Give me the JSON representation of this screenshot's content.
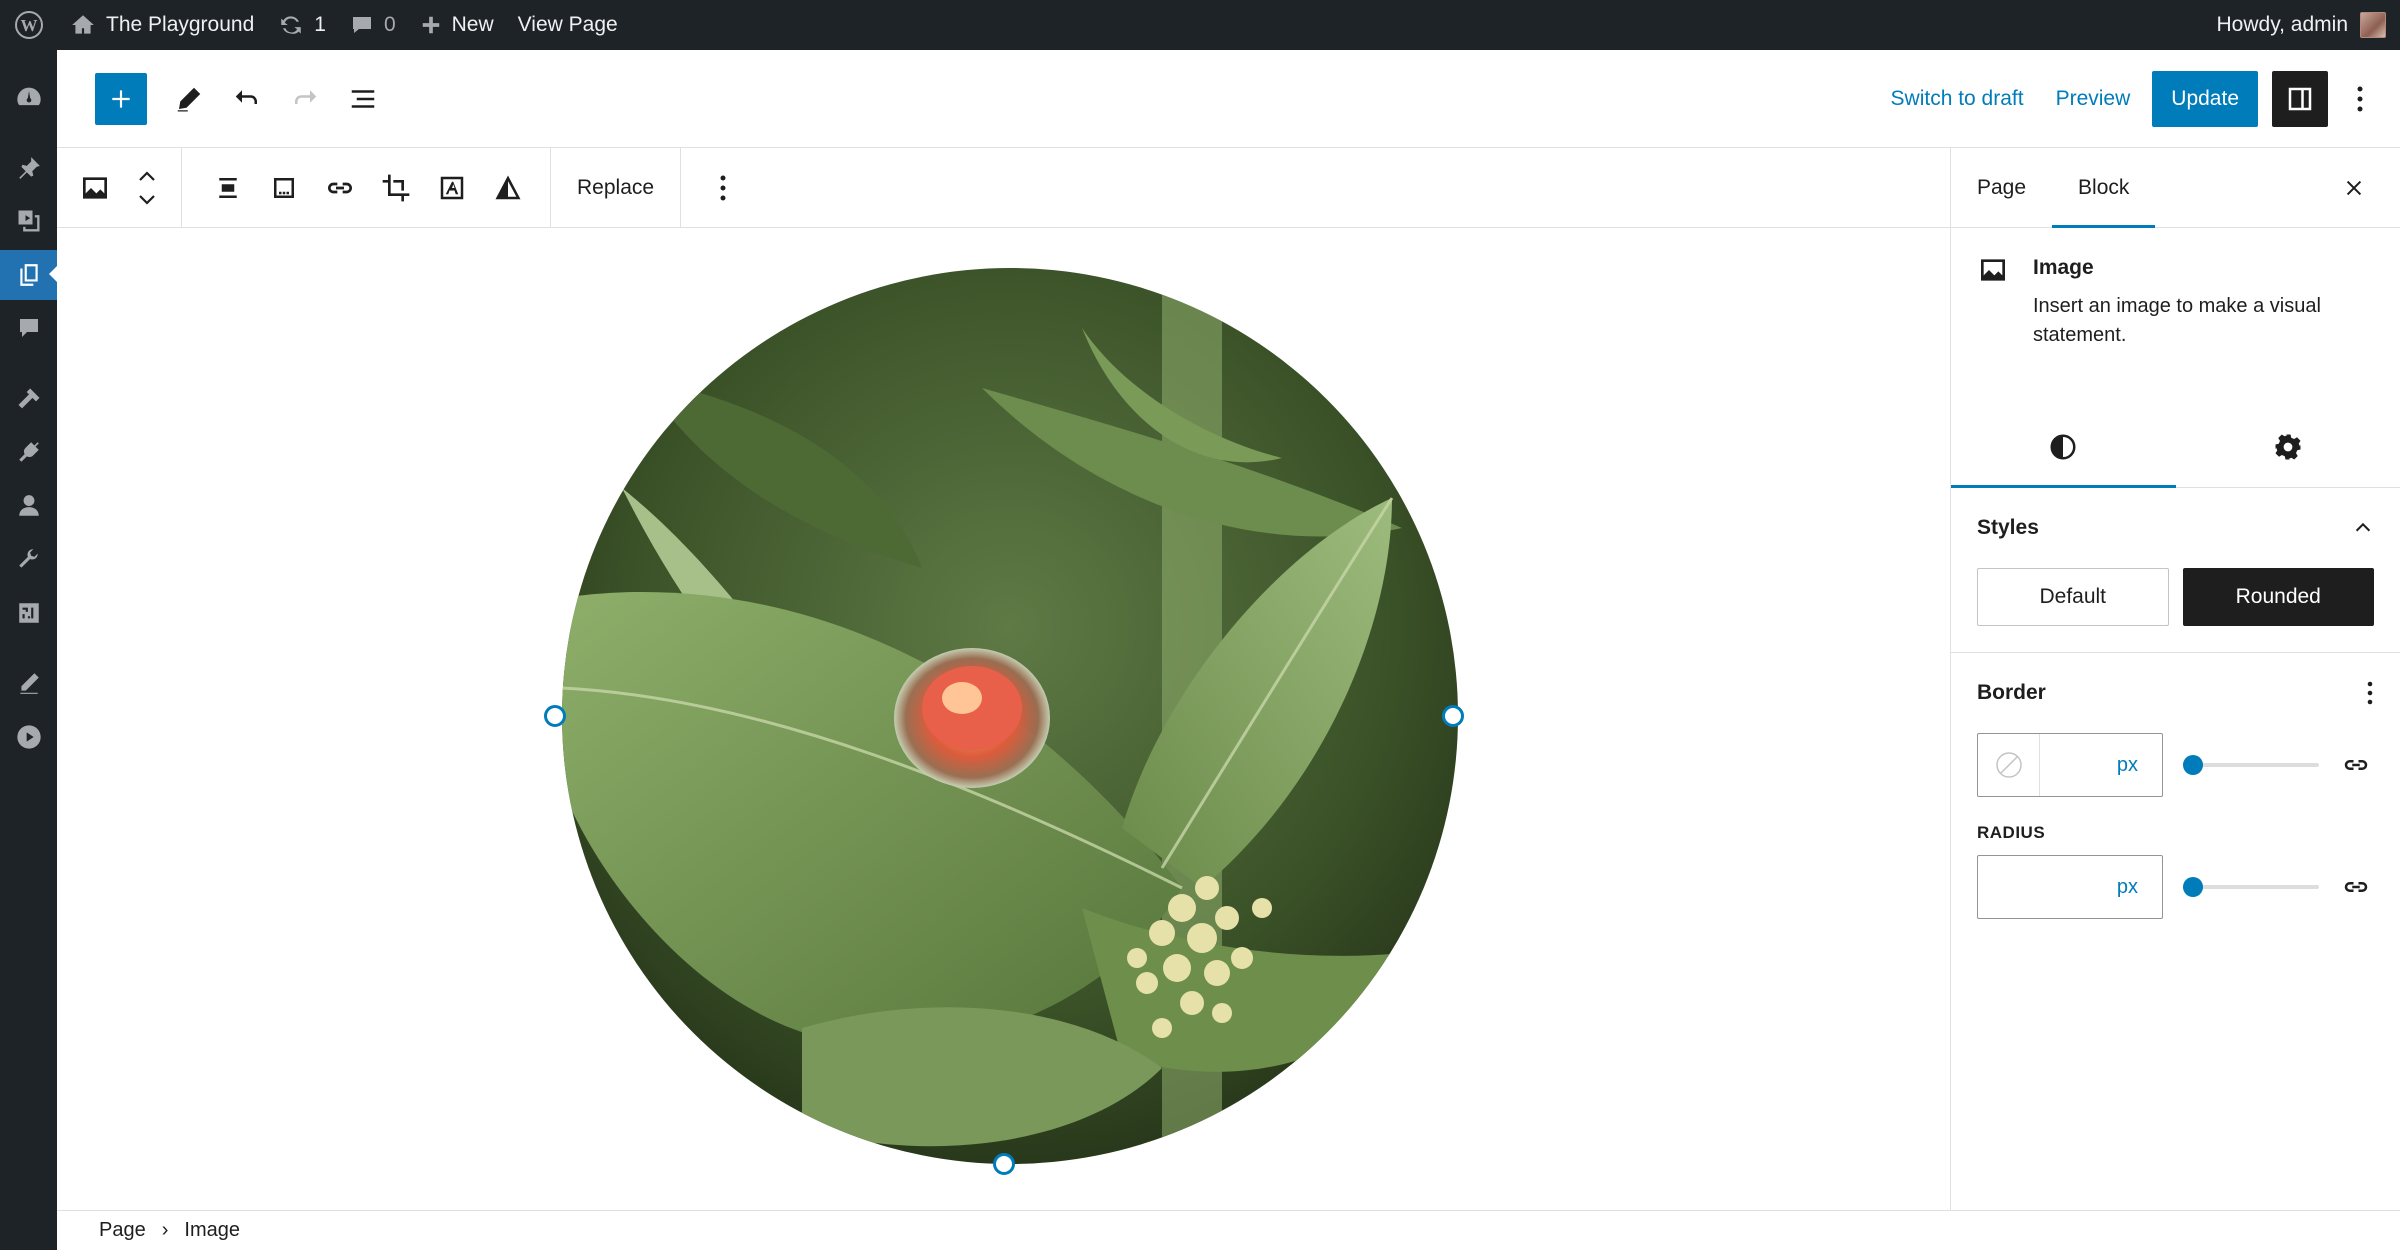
{
  "admin_bar": {
    "site_name": "The Playground",
    "updates_count": "1",
    "comments_count": "0",
    "new_label": "New",
    "view_page_label": "View Page",
    "greeting": "Howdy, admin"
  },
  "admin_menu": {
    "items": [
      "dashboard-icon",
      "posts-icon",
      "media-icon",
      "pages-icon",
      "comments-icon",
      "appearance-icon",
      "plugins-icon",
      "users-icon",
      "tools-icon",
      "settings-icon",
      "edit-icon",
      "video-icon"
    ],
    "active": "pages-icon"
  },
  "header": {
    "switch_to_draft": "Switch to draft",
    "preview": "Preview",
    "update": "Update"
  },
  "block_toolbar": {
    "replace": "Replace"
  },
  "canvas": {
    "image_style": "Rounded"
  },
  "breadcrumb": {
    "items": [
      "Page",
      "Image"
    ]
  },
  "sidebar": {
    "tabs": [
      "Page",
      "Block"
    ],
    "active_tab": "Block",
    "block_card": {
      "title": "Image",
      "description": "Insert an image to make a visual statement."
    },
    "styles": {
      "title": "Styles",
      "options": [
        "Default",
        "Rounded"
      ],
      "selected": "Rounded"
    },
    "border": {
      "title": "Border",
      "width_unit": "px",
      "radius_label": "RADIUS",
      "radius_unit": "px"
    }
  },
  "colors": {
    "accent": "#007cba",
    "admin_bg": "#1d2327"
  }
}
